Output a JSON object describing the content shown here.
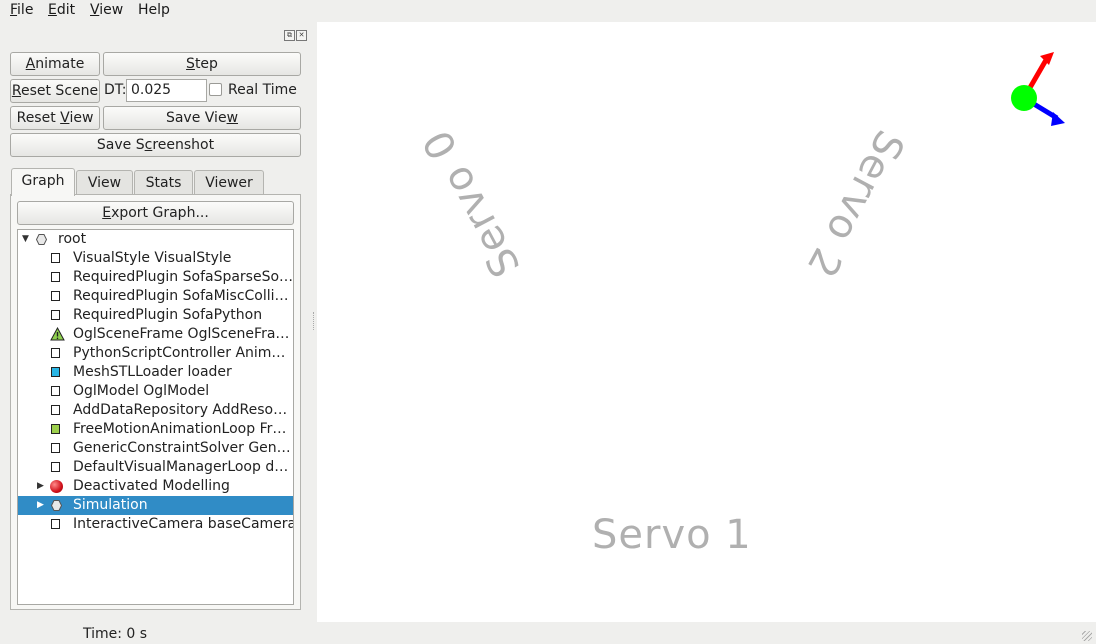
{
  "menu": [
    {
      "pre": "",
      "u": "F",
      "post": "ile"
    },
    {
      "pre": "",
      "u": "E",
      "post": "dit"
    },
    {
      "pre": "",
      "u": "V",
      "post": "iew"
    },
    {
      "pre": "",
      "u": "",
      "post": "Help"
    }
  ],
  "controls": {
    "animate": {
      "pre": "",
      "u": "A",
      "post": "nimate"
    },
    "step": {
      "pre": "",
      "u": "S",
      "post": "tep"
    },
    "reset_scene": {
      "pre": "",
      "u": "R",
      "post": "eset Scene"
    },
    "dt_label": "DT:",
    "dt_value": "0.025",
    "real_time_label": "Real Time",
    "real_time_checked": false,
    "reset_view": {
      "pre": "Reset ",
      "u": "V",
      "post": "iew"
    },
    "save_view": {
      "pre": "Save Vie",
      "u": "w",
      "post": ""
    },
    "save_screenshot": {
      "pre": "Save S",
      "u": "c",
      "post": "reenshot"
    }
  },
  "tabs": [
    "Graph",
    "View",
    "Stats",
    "Viewer"
  ],
  "active_tab": "Graph",
  "export_graph": {
    "pre": "",
    "u": "E",
    "post": "xport Graph..."
  },
  "tree": [
    {
      "label": "root",
      "icon": "hexagon-icon",
      "expanded": true,
      "level": 0
    },
    {
      "label": "VisualStyle VisualStyle",
      "icon": "box-icon",
      "level": 1
    },
    {
      "label": "RequiredPlugin SofaSparseSo…",
      "icon": "box-icon",
      "level": 1
    },
    {
      "label": "RequiredPlugin SofaMiscColli…",
      "icon": "box-icon",
      "level": 1
    },
    {
      "label": "RequiredPlugin SofaPython",
      "icon": "box-icon",
      "level": 1
    },
    {
      "label": "OglSceneFrame OglSceneFra…",
      "icon": "warning-triangle-icon",
      "level": 1
    },
    {
      "label": "PythonScriptController Anim…",
      "icon": "box-icon",
      "level": 1
    },
    {
      "label": "MeshSTLLoader loader",
      "icon": "cyan-box-icon",
      "level": 1
    },
    {
      "label": "OglModel OglModel",
      "icon": "box-icon",
      "level": 1
    },
    {
      "label": "AddDataRepository AddReso…",
      "icon": "box-icon",
      "level": 1
    },
    {
      "label": "FreeMotionAnimationLoop Fr…",
      "icon": "green-box-icon",
      "level": 1
    },
    {
      "label": "GenericConstraintSolver Gen…",
      "icon": "box-icon",
      "level": 1
    },
    {
      "label": "DefaultVisualManagerLoop d…",
      "icon": "box-icon",
      "level": 1
    },
    {
      "label": "Deactivated Modelling",
      "icon": "red-ball-icon",
      "collapsed": true,
      "level": 1
    },
    {
      "label": "Simulation",
      "icon": "hexagon-icon",
      "collapsed": true,
      "selected": true,
      "level": 1
    },
    {
      "label": "InteractiveCamera baseCamera",
      "icon": "box-icon",
      "level": 1
    }
  ],
  "viewport": {
    "labels": [
      "Servo 0",
      "Servo 2",
      "Servo 1"
    ],
    "axis_colors": {
      "x": "#ff0000",
      "y": "#00ff00",
      "z": "#0000ff"
    }
  },
  "status": {
    "time": "Time: 0 s"
  }
}
